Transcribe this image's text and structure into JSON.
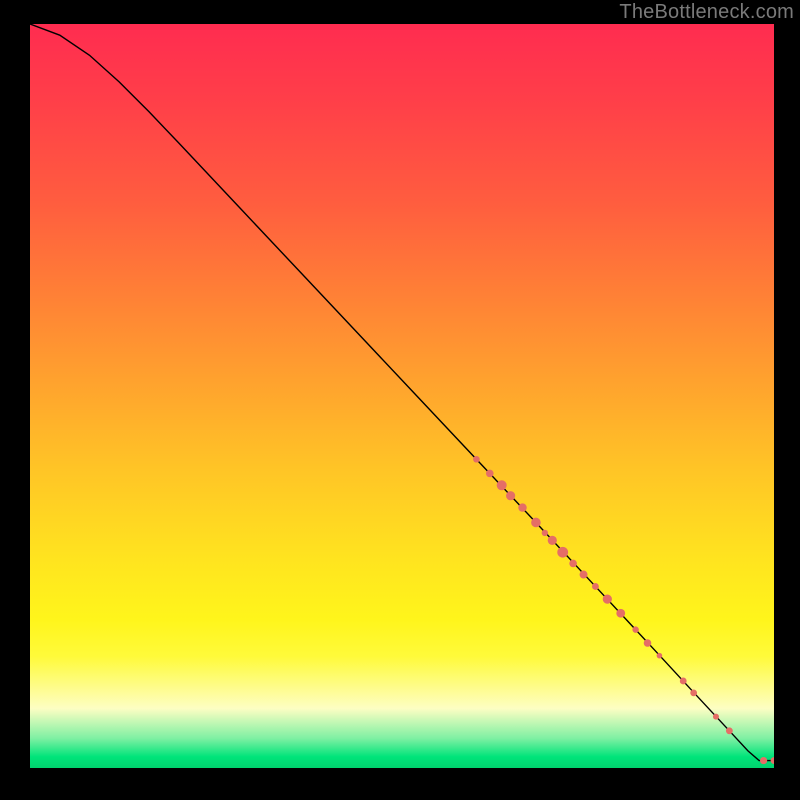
{
  "attribution": "TheBottleneck.com",
  "chart_data": {
    "type": "line",
    "title": "",
    "xlabel": "",
    "ylabel": "",
    "xlim": [
      0,
      100
    ],
    "ylim": [
      0,
      100
    ],
    "grid": false,
    "legend": false,
    "curve": {
      "comment": "Decreasing curve from top-left to bottom-right; values estimated from plot height (no axis labels present).",
      "x": [
        0,
        4,
        8,
        12,
        16,
        20,
        28,
        36,
        44,
        52,
        60,
        68,
        76,
        84,
        90,
        94,
        96.5,
        98,
        100
      ],
      "y": [
        100,
        98.5,
        95.8,
        92.2,
        88.2,
        84.0,
        75.5,
        67.0,
        58.5,
        50.0,
        41.5,
        33.0,
        24.4,
        15.8,
        9.3,
        5.0,
        2.3,
        1.0,
        1.0
      ]
    },
    "markers": {
      "comment": "Salmon dots along the lower-right portion of the curve; radius in pixel units.",
      "color": "#e56e66",
      "points": [
        {
          "x": 60.0,
          "y": 41.5,
          "r": 3.3
        },
        {
          "x": 61.8,
          "y": 39.6,
          "r": 3.8
        },
        {
          "x": 63.4,
          "y": 38.0,
          "r": 5.0
        },
        {
          "x": 64.6,
          "y": 36.6,
          "r": 4.6
        },
        {
          "x": 66.2,
          "y": 35.0,
          "r": 4.2
        },
        {
          "x": 68.0,
          "y": 33.0,
          "r": 4.8
        },
        {
          "x": 69.2,
          "y": 31.6,
          "r": 3.2
        },
        {
          "x": 70.2,
          "y": 30.6,
          "r": 4.6
        },
        {
          "x": 71.6,
          "y": 29.0,
          "r": 5.4
        },
        {
          "x": 73.0,
          "y": 27.5,
          "r": 3.8
        },
        {
          "x": 74.4,
          "y": 26.0,
          "r": 4.0
        },
        {
          "x": 76.0,
          "y": 24.4,
          "r": 3.4
        },
        {
          "x": 77.6,
          "y": 22.7,
          "r": 4.6
        },
        {
          "x": 79.4,
          "y": 20.8,
          "r": 4.4
        },
        {
          "x": 81.4,
          "y": 18.6,
          "r": 3.2
        },
        {
          "x": 83.0,
          "y": 16.8,
          "r": 3.8
        },
        {
          "x": 84.6,
          "y": 15.1,
          "r": 2.8
        },
        {
          "x": 87.8,
          "y": 11.7,
          "r": 3.4
        },
        {
          "x": 89.2,
          "y": 10.1,
          "r": 3.4
        },
        {
          "x": 92.2,
          "y": 6.9,
          "r": 3.0
        },
        {
          "x": 94.0,
          "y": 5.0,
          "r": 3.4
        },
        {
          "x": 98.6,
          "y": 1.0,
          "r": 3.6
        },
        {
          "x": 100.0,
          "y": 1.0,
          "r": 3.4
        }
      ]
    }
  }
}
